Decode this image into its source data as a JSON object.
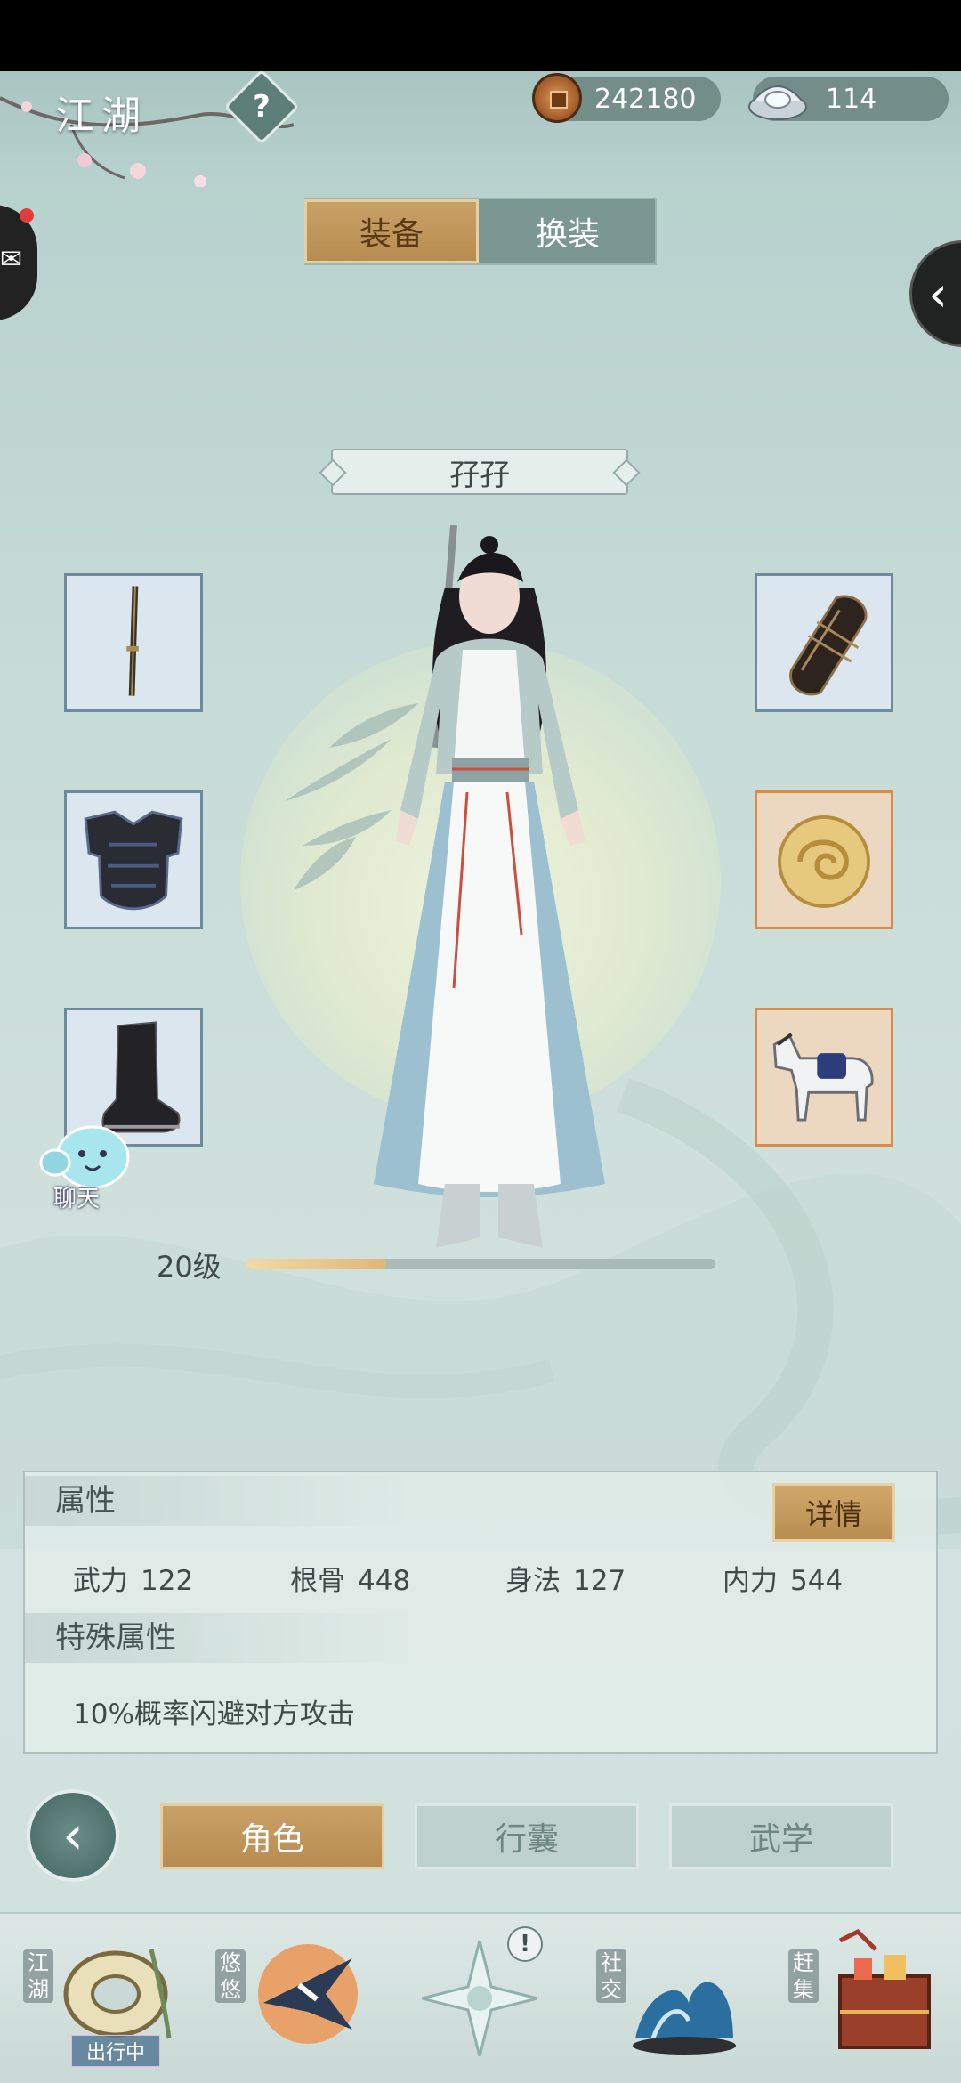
{
  "header": {
    "region_title": "江湖",
    "help_icon": "question-mark-icon",
    "copper_value": "242180",
    "silver_value": "114"
  },
  "tabs": {
    "equip_label": "装备",
    "outfit_label": "换装",
    "active": "装备"
  },
  "character": {
    "name": "孖孖",
    "level_label": "20级",
    "level_progress": 0.3
  },
  "equipment_slots": {
    "left": [
      "sword-icon",
      "chest-armor-icon",
      "boots-icon"
    ],
    "right": [
      "bracer-icon",
      "jade-pendant-icon",
      "horse-icon"
    ]
  },
  "chat_bubble": {
    "label": "聊天"
  },
  "attributes": {
    "title": "属性",
    "detail_label": "详情",
    "stats": [
      {
        "name": "武力",
        "value": "122"
      },
      {
        "name": "根骨",
        "value": "448"
      },
      {
        "name": "身法",
        "value": "127"
      },
      {
        "name": "内力",
        "value": "544"
      }
    ],
    "special_title": "特殊属性",
    "special_text": "10%概率闪避对方攻击"
  },
  "bottom_nav": {
    "items": [
      {
        "label": "角色",
        "active": true
      },
      {
        "label": "行囊",
        "active": false
      },
      {
        "label": "武学",
        "active": false
      }
    ]
  },
  "dock": {
    "items": [
      {
        "label": "江湖",
        "badge": "出行中"
      },
      {
        "label": "悠悠"
      },
      {
        "label": ""
      },
      {
        "label": "社交"
      },
      {
        "label": "赶集"
      }
    ],
    "notice": "!"
  },
  "colors": {
    "accent_gold": "#c8a167",
    "background": "#c7dbd7",
    "level_fill": "#e0b778"
  }
}
